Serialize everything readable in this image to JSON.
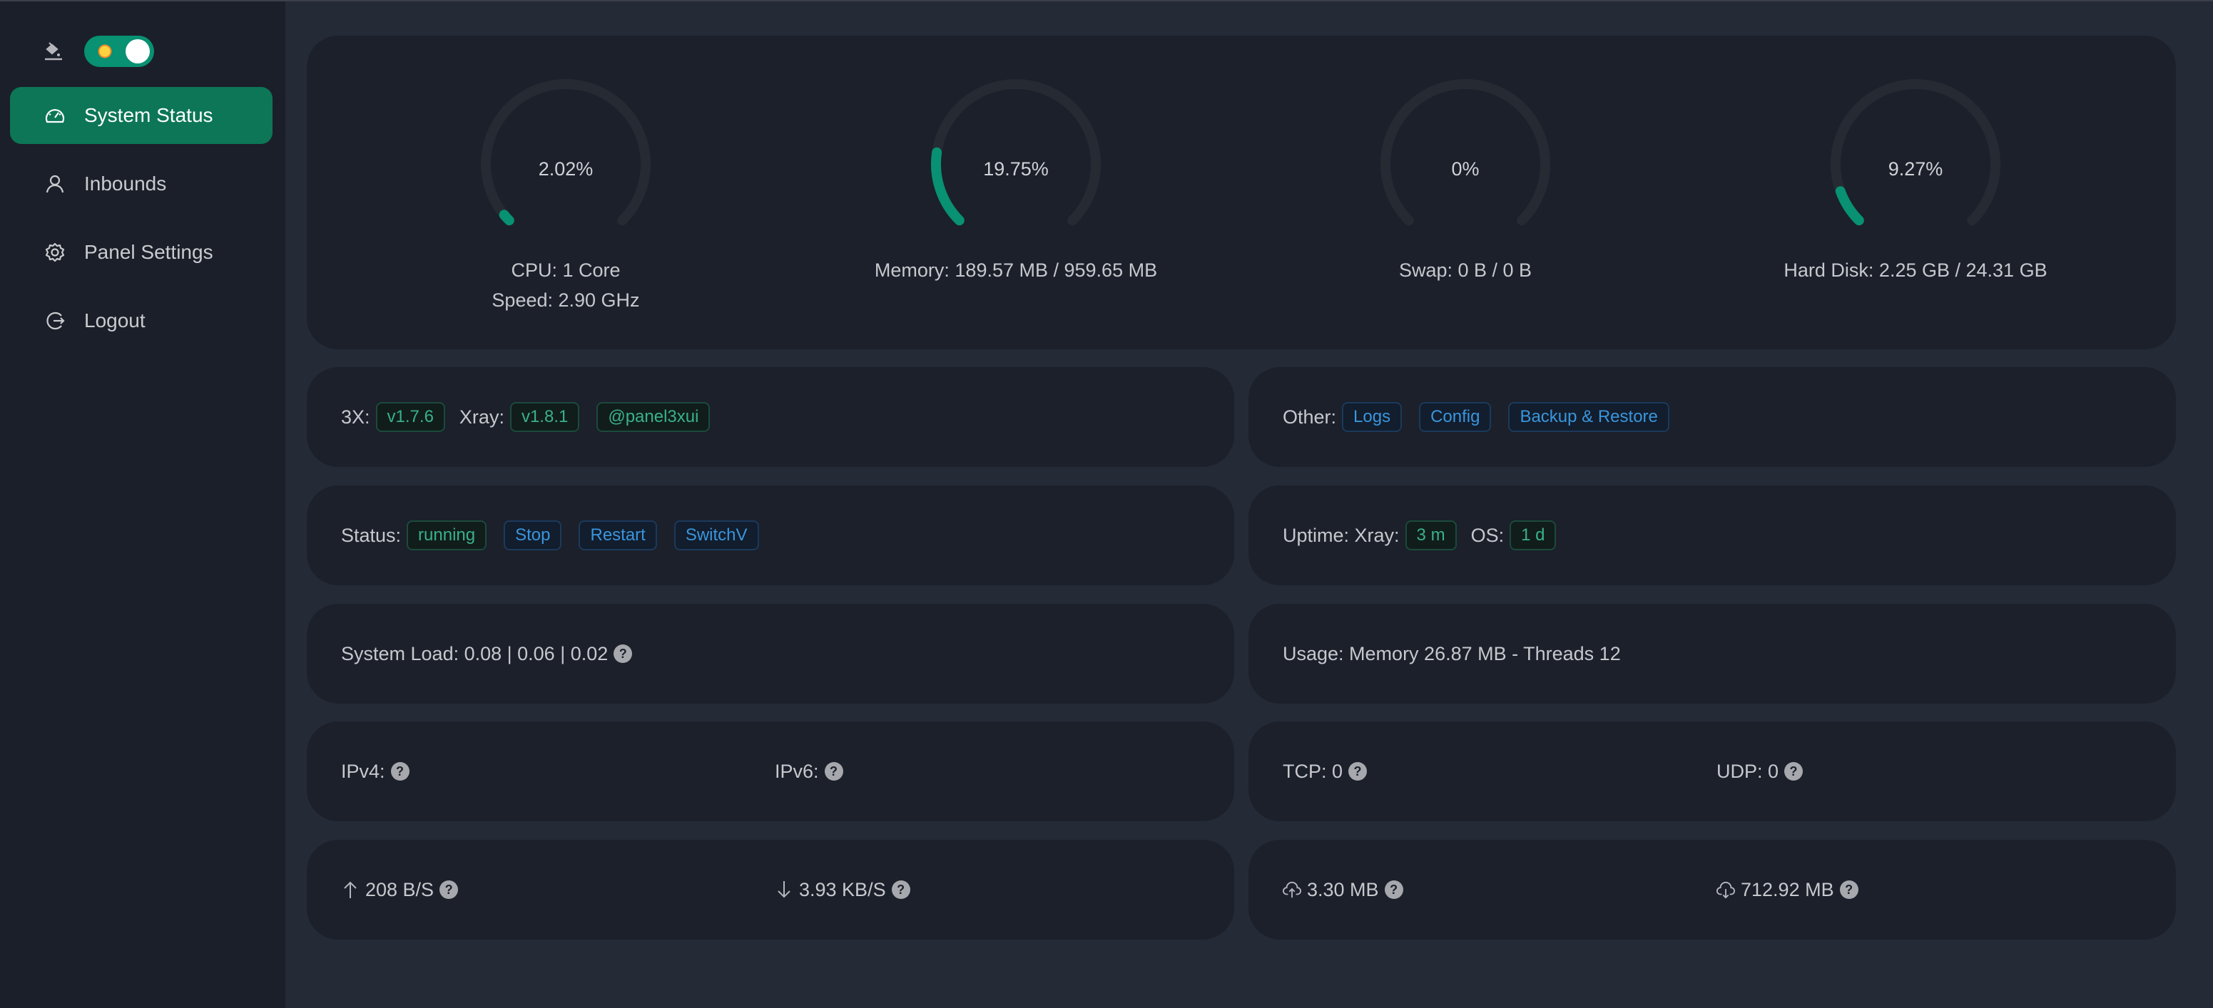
{
  "theme": {
    "toggle_on": true,
    "mode_icon": "sun-icon"
  },
  "sidebar": {
    "items": [
      {
        "label": "System Status",
        "icon": "dashboard-icon",
        "active": true
      },
      {
        "label": "Inbounds",
        "icon": "user-icon",
        "active": false
      },
      {
        "label": "Panel Settings",
        "icon": "gear-icon",
        "active": false
      },
      {
        "label": "Logout",
        "icon": "logout-icon",
        "active": false
      }
    ]
  },
  "gauges": [
    {
      "percent_text": "2.02%",
      "percent": 2.02,
      "line1": "CPU: 1 Core",
      "line2": "Speed: 2.90 GHz"
    },
    {
      "percent_text": "19.75%",
      "percent": 19.75,
      "line1": "Memory: 189.57 MB / 959.65 MB",
      "line2": ""
    },
    {
      "percent_text": "0%",
      "percent": 0,
      "line1": "Swap: 0 B / 0 B",
      "line2": ""
    },
    {
      "percent_text": "9.27%",
      "percent": 9.27,
      "line1": "Hard Disk: 2.25 GB / 24.31 GB",
      "line2": ""
    }
  ],
  "versions": {
    "label_3x": "3X:",
    "v3x": "v1.7.6",
    "label_xray": "Xray:",
    "vxray": "v1.8.1",
    "channel": "@panel3xui"
  },
  "other": {
    "label": "Other:",
    "logs": "Logs",
    "config": "Config",
    "backup": "Backup & Restore"
  },
  "status": {
    "label": "Status:",
    "state": "running",
    "stop": "Stop",
    "restart": "Restart",
    "switch": "SwitchV"
  },
  "uptime": {
    "label": "Uptime: Xray:",
    "xray": "3 m",
    "os_label": "OS:",
    "os": "1 d"
  },
  "load": {
    "text": "System Load: 0.08 | 0.06 | 0.02"
  },
  "usage": {
    "text": "Usage: Memory 26.87 MB - Threads 12"
  },
  "ip": {
    "ipv4": "IPv4:",
    "ipv6": "IPv6:"
  },
  "conn": {
    "tcp": "TCP: 0",
    "udp": "UDP: 0"
  },
  "speed": {
    "up": "208 B/S",
    "down": "3.93 KB/S"
  },
  "traffic": {
    "sent": "3.30 MB",
    "received": "712.92 MB"
  },
  "colors": {
    "accent": "#0c7656",
    "gauge": "#089172",
    "track": "#252a33"
  }
}
